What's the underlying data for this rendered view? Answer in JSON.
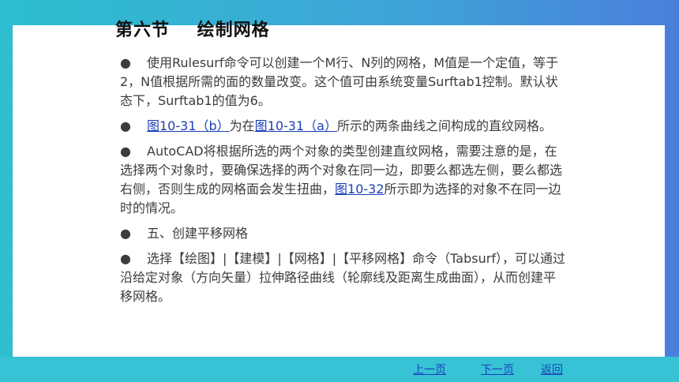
{
  "title": "第六节    绘制网格",
  "bullet": "●",
  "paragraphs": {
    "p1": "使用Rulesurf命令可以创建一个M行、N列的网格，M值是一个定值，等于2，N值根据所需的面的数量改变。这个值可由系统变量Surftab1控制。默认状态下，Surftab1的值为6。",
    "p2": {
      "link1": "图10-31（b）",
      "text1": "为在",
      "link2": "图10-31（a）",
      "text2": "所示的两条曲线之间构成的直纹网格。"
    },
    "p3": {
      "text1": "AutoCAD将根据所选的两个对象的类型创建直纹网格，需要注意的是，在选择两个对象时，要确保选择的两个对象在同一边，即要么都选左侧，要么都选右侧，否则生成的网格面会发生扭曲，",
      "link": "图10-32",
      "text2": "所示即为选择的对象不在同一边时的情况。"
    },
    "p4": "五、创建平移网格",
    "p5": "选择【绘图】|【建模】|【网格】|【平移网格】命令（Tabsurf），可以通过沿给定对象（方向矢量）拉伸路径曲线（轮廓线及距离生成曲面），从而创建平移网格。"
  },
  "nav": {
    "prev": "上一页",
    "next": "下一页",
    "back": "返回"
  }
}
